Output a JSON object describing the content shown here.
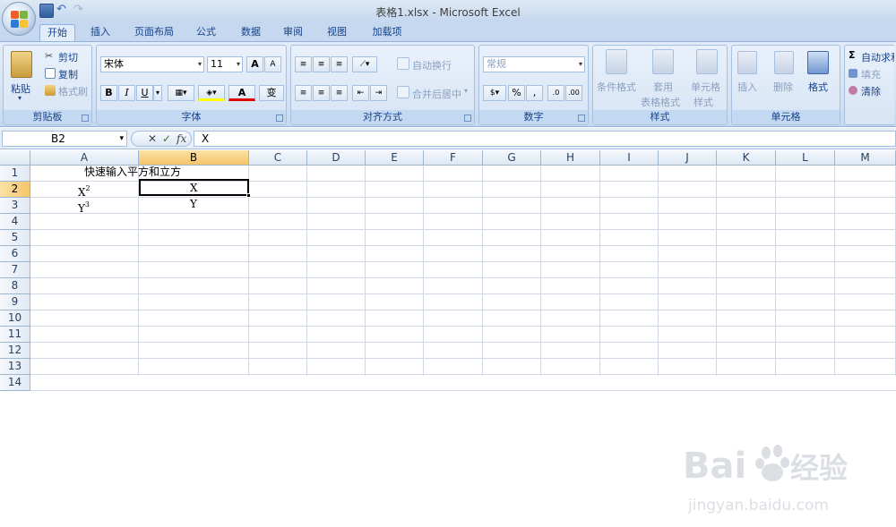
{
  "window": {
    "title": "表格1.xlsx - Microsoft Excel"
  },
  "tabs": [
    {
      "label": "开始",
      "active": true
    },
    {
      "label": "插入"
    },
    {
      "label": "页面布局"
    },
    {
      "label": "公式"
    },
    {
      "label": "数据"
    },
    {
      "label": "审阅"
    },
    {
      "label": "视图"
    },
    {
      "label": "加载项"
    }
  ],
  "ribbon": {
    "clipboard": {
      "title": "剪贴板",
      "paste": "粘贴",
      "cut": "剪切",
      "copy": "复制",
      "format_painter": "格式刷"
    },
    "font": {
      "title": "字体",
      "font_name": "宋体",
      "font_size": "11",
      "bold": "B",
      "italic": "I",
      "underline": "U",
      "font_color": "A",
      "grow": "A",
      "shrink": "A",
      "phonetic": "变"
    },
    "alignment": {
      "title": "对齐方式",
      "wrap": "自动换行",
      "merge": "合并后居中"
    },
    "number": {
      "title": "数字",
      "format": "常规",
      "percent": "%",
      "comma": ","
    },
    "styles": {
      "title": "样式",
      "conditional": "条件格式",
      "table1": "套用",
      "table2": "表格格式",
      "cell1": "单元格",
      "cell2": "样式"
    },
    "cells": {
      "title": "单元格",
      "insert": "插入",
      "delete": "删除",
      "format": "格式"
    },
    "editing": {
      "autosum": "自动求和",
      "fill": "填充",
      "clear": "清除"
    }
  },
  "formula_bar": {
    "name_box": "B2",
    "fx": "fx",
    "content": "X"
  },
  "columns": [
    "A",
    "B",
    "C",
    "D",
    "E",
    "F",
    "G",
    "H",
    "I",
    "J",
    "K",
    "L",
    "M"
  ],
  "rows": [
    "1",
    "2",
    "3",
    "4",
    "5",
    "6",
    "7",
    "8",
    "9",
    "10",
    "11",
    "12",
    "13",
    "14"
  ],
  "cells": {
    "A1": "快速输入平方和立方",
    "A2_base": "X",
    "A2_exp": "2",
    "A3_base": "Y",
    "A3_exp": "3",
    "B2": "X",
    "B3": "Y"
  },
  "watermark": {
    "text1": "Bai",
    "text2": "du",
    "text3": "经验",
    "url": "jingyan.baidu.com"
  },
  "colors": {
    "accent": "#15428b",
    "selected_header": "#f5c46a",
    "ribbon": "#d3e1f3"
  }
}
